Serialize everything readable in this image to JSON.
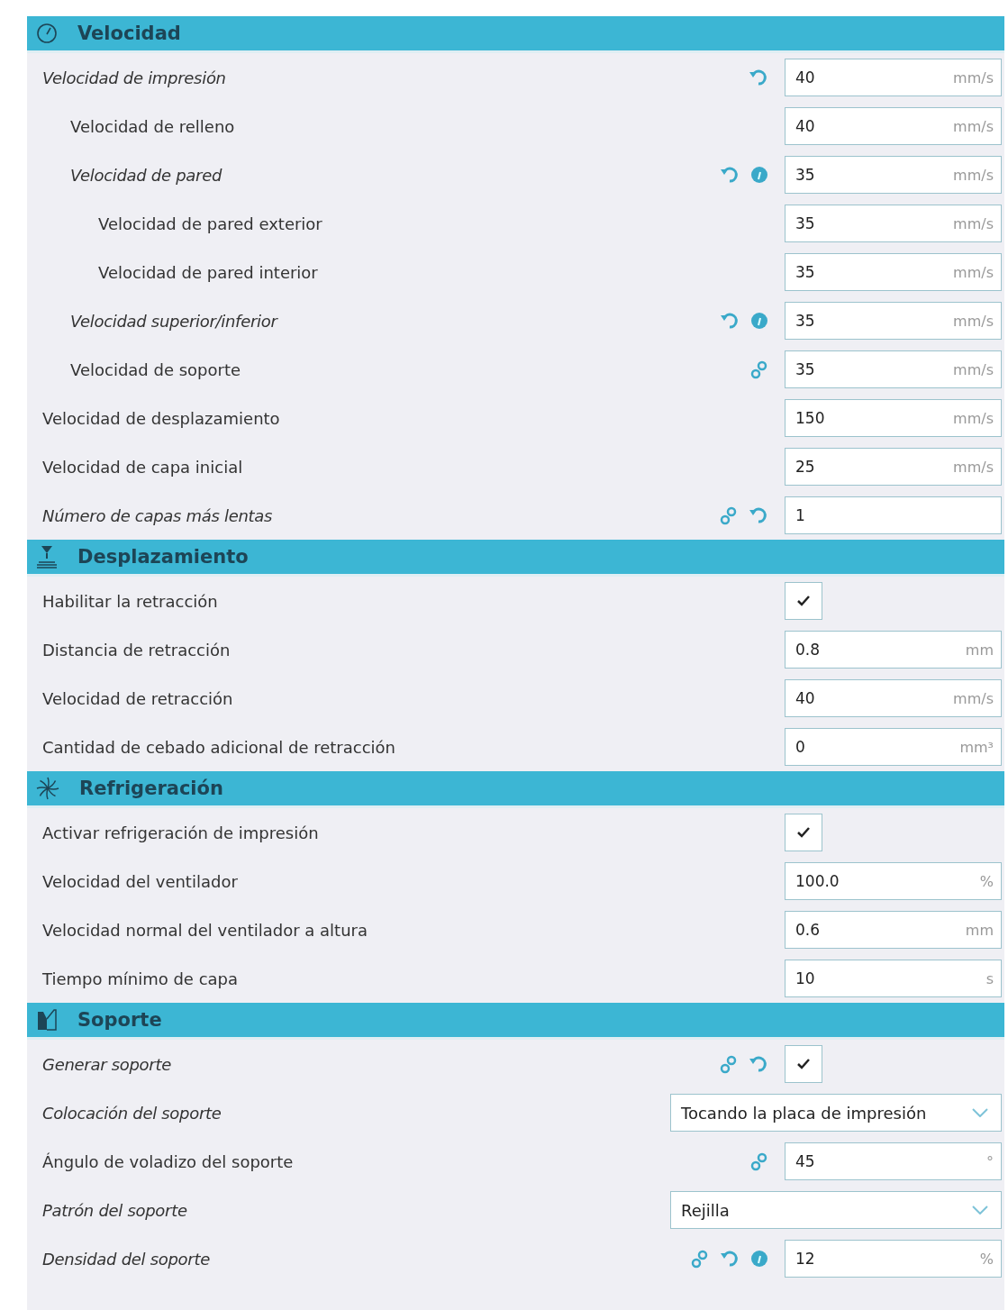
{
  "sections": [
    {
      "title": "Velocidad",
      "settings": [
        {
          "label": "Velocidad de impresión",
          "modified": true,
          "link": false,
          "reset": true,
          "info": false,
          "control": {
            "kind": "number",
            "value": "40",
            "unit": "mm/s"
          },
          "children": [
            {
              "label": "Velocidad de relleno",
              "modified": false,
              "link": false,
              "reset": false,
              "info": false,
              "control": {
                "kind": "number",
                "value": "40",
                "unit": "mm/s"
              }
            },
            {
              "label": "Velocidad de pared",
              "modified": true,
              "link": false,
              "reset": true,
              "info": true,
              "control": {
                "kind": "number",
                "value": "35",
                "unit": "mm/s"
              },
              "children": [
                {
                  "label": "Velocidad de pared exterior",
                  "modified": false,
                  "link": false,
                  "reset": false,
                  "info": false,
                  "control": {
                    "kind": "number",
                    "value": "35",
                    "unit": "mm/s"
                  }
                },
                {
                  "label": "Velocidad de pared interior",
                  "modified": false,
                  "link": false,
                  "reset": false,
                  "info": false,
                  "control": {
                    "kind": "number",
                    "value": "35",
                    "unit": "mm/s"
                  }
                }
              ]
            },
            {
              "label": "Velocidad superior/inferior",
              "modified": true,
              "link": false,
              "reset": true,
              "info": true,
              "control": {
                "kind": "number",
                "value": "35",
                "unit": "mm/s"
              }
            },
            {
              "label": "Velocidad de soporte",
              "modified": false,
              "link": true,
              "reset": false,
              "info": false,
              "control": {
                "kind": "number",
                "value": "35",
                "unit": "mm/s"
              }
            }
          ]
        },
        {
          "label": "Velocidad de desplazamiento",
          "modified": false,
          "link": false,
          "reset": false,
          "info": false,
          "control": {
            "kind": "number",
            "value": "150",
            "unit": "mm/s"
          }
        },
        {
          "label": "Velocidad de capa inicial",
          "modified": false,
          "link": false,
          "reset": false,
          "info": false,
          "control": {
            "kind": "number",
            "value": "25",
            "unit": "mm/s"
          }
        },
        {
          "label": "Número de capas más lentas",
          "modified": true,
          "link": true,
          "reset": true,
          "info": false,
          "control": {
            "kind": "number",
            "value": "1"
          }
        }
      ]
    },
    {
      "title": "Desplazamiento",
      "settings": [
        {
          "label": "Habilitar la retracción",
          "modified": false,
          "link": false,
          "reset": false,
          "info": false,
          "control": {
            "kind": "checkbox",
            "checked": true
          }
        },
        {
          "label": "Distancia de retracción",
          "modified": false,
          "link": false,
          "reset": false,
          "info": false,
          "control": {
            "kind": "number",
            "value": "0.8",
            "unit": "mm"
          }
        },
        {
          "label": "Velocidad de retracción",
          "modified": false,
          "link": false,
          "reset": false,
          "info": false,
          "control": {
            "kind": "number",
            "value": "40",
            "unit": "mm/s"
          }
        },
        {
          "label": "Cantidad de cebado adicional de retracción",
          "modified": false,
          "link": false,
          "reset": false,
          "info": false,
          "control": {
            "kind": "number",
            "value": "0",
            "unit": "mm³"
          }
        }
      ]
    },
    {
      "title": "Refrigeración",
      "settings": [
        {
          "label": "Activar refrigeración de impresión",
          "modified": false,
          "link": false,
          "reset": false,
          "info": false,
          "control": {
            "kind": "checkbox",
            "checked": true
          }
        },
        {
          "label": "Velocidad del ventilador",
          "modified": false,
          "link": false,
          "reset": false,
          "info": false,
          "control": {
            "kind": "number",
            "value": "100.0",
            "unit": "%"
          }
        },
        {
          "label": "Velocidad normal del ventilador a altura",
          "modified": false,
          "link": false,
          "reset": false,
          "info": false,
          "control": {
            "kind": "number",
            "value": "0.6",
            "unit": "mm"
          }
        },
        {
          "label": "Tiempo mínimo de capa",
          "modified": false,
          "link": false,
          "reset": false,
          "info": false,
          "control": {
            "kind": "number",
            "value": "10",
            "unit": "s"
          }
        }
      ]
    },
    {
      "title": "Soporte",
      "settings": [
        {
          "label": "Generar soporte",
          "modified": true,
          "link": true,
          "reset": true,
          "info": false,
          "control": {
            "kind": "checkbox",
            "checked": true
          }
        },
        {
          "label": "Colocación del soporte",
          "modified": true,
          "link": false,
          "reset": false,
          "info": false,
          "control": {
            "kind": "select",
            "value": "Tocando la placa de impresión"
          }
        },
        {
          "label": "Ángulo de voladizo del soporte",
          "modified": false,
          "link": true,
          "reset": false,
          "info": false,
          "control": {
            "kind": "number",
            "value": "45",
            "unit": "°"
          }
        },
        {
          "label": "Patrón del soporte",
          "modified": true,
          "link": false,
          "reset": false,
          "info": false,
          "control": {
            "kind": "select",
            "value": "Rejilla"
          }
        },
        {
          "label": "Densidad del soporte",
          "modified": true,
          "link": true,
          "reset": true,
          "info": true,
          "control": {
            "kind": "number",
            "value": "12",
            "unit": "%"
          }
        }
      ]
    }
  ]
}
